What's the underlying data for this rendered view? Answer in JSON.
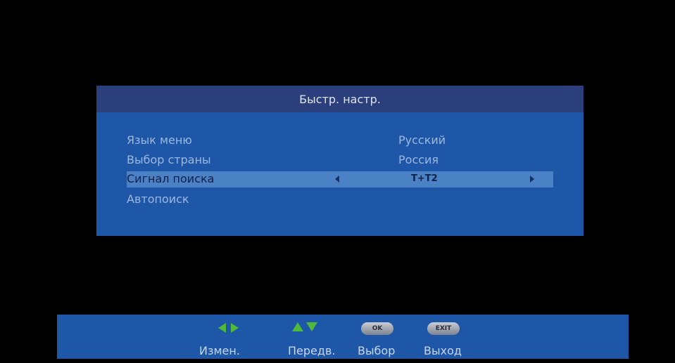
{
  "dialog": {
    "title": "Быстр. настр.",
    "items": [
      {
        "label": "Язык меню",
        "value": "Русский"
      },
      {
        "label": "Выбор страны",
        "value": "Россия"
      },
      {
        "label": "Сигнал поиска",
        "value": "T+T2"
      },
      {
        "label": "Автопоиск",
        "value": ""
      }
    ]
  },
  "footer": {
    "change_label": "Измен.",
    "move_label": "Передв.",
    "ok_key": "OK",
    "select_label": "Выбор",
    "exit_key": "EXIT",
    "exit_label": "Выход"
  },
  "colors": {
    "panel": "#1e56a8",
    "title_bar": "#2b3f7c",
    "highlight": "#4b81c5",
    "arrow_green": "#4fb93a"
  },
  "icons": {
    "change": "left-right-arrows-icon",
    "move": "up-down-arrows-icon",
    "ok": "ok-key-icon",
    "exit": "exit-key-icon"
  }
}
